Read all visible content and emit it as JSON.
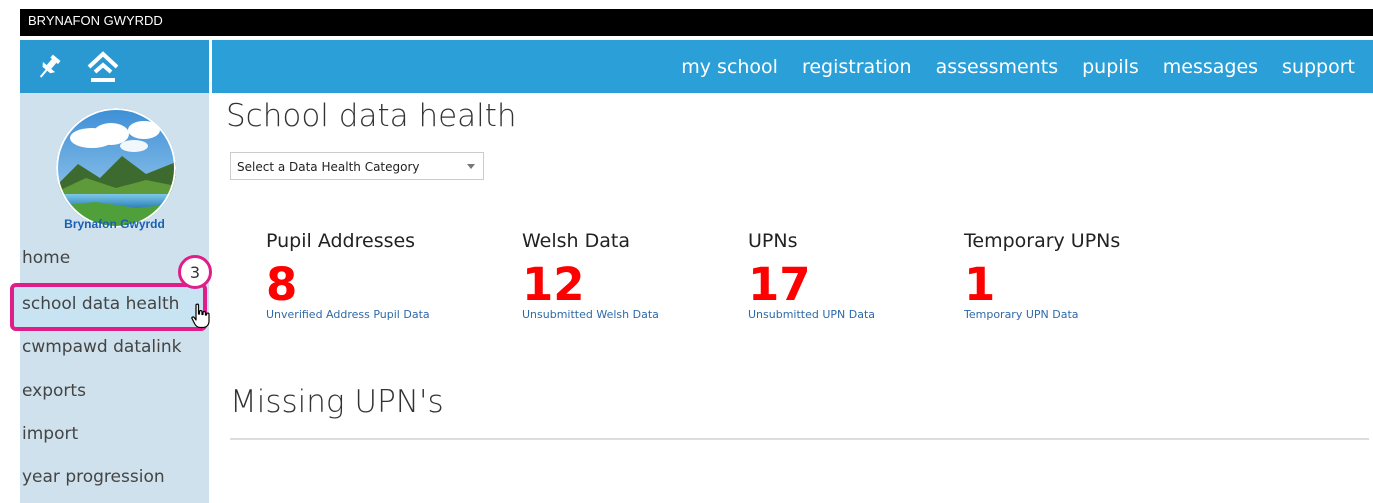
{
  "header": {
    "school_name": "BRYNAFON GWYRDD"
  },
  "toolbar": {
    "icons": [
      "pin-icon",
      "home-icon"
    ]
  },
  "nav": {
    "links": [
      "my school",
      "registration",
      "assessments",
      "pupils",
      "messages",
      "support"
    ],
    "color": "#2b9fd8"
  },
  "sidebar": {
    "logo_label": "Brynafon Gwyrdd",
    "items": [
      "home",
      "school data health",
      "cwmpawd datalink",
      "exports",
      "import",
      "year progression"
    ],
    "active_index": 1,
    "step_badge": "3",
    "highlight_color": "#e01e8a"
  },
  "main": {
    "title": "School data health",
    "dropdown": {
      "selected": "Select a Data Health Category"
    },
    "stats": [
      {
        "title": "Pupil Addresses",
        "value": "8",
        "link": "Unverified Address Pupil Data"
      },
      {
        "title": "Welsh Data",
        "value": "12",
        "link": "Unsubmitted Welsh Data"
      },
      {
        "title": "UPNs",
        "value": "17",
        "link": "Unsubmitted UPN Data"
      },
      {
        "title": "Temporary UPNs",
        "value": "1",
        "link": "Temporary UPN Data"
      }
    ],
    "section_title": "Missing UPN's"
  }
}
